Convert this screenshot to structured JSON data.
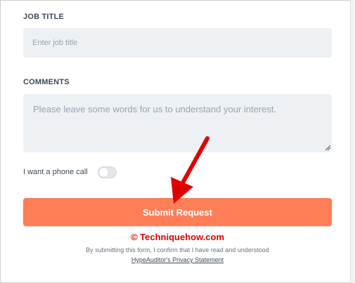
{
  "form": {
    "job_title_label": "JOB TITLE",
    "job_title_placeholder": "Enter job title",
    "job_title_value": "",
    "comments_label": "COMMENTS",
    "comments_placeholder": "Please leave some words for us to understand your interest.",
    "comments_value": "",
    "phone_call_label": "I want a phone call",
    "phone_call_on": false,
    "submit_label": "Submit Request",
    "consent_text": "By submitting this form, I confirm that I have read and understood",
    "privacy_link": "HypeAuditor's Privacy Statement"
  },
  "watermark": {
    "text": "© Techniquehow.com",
    "color": "#e10000"
  },
  "colors": {
    "accent": "#fd7e57",
    "input_bg": "#eef1f4",
    "arrow": "#e10000"
  },
  "icons": {
    "annotation": "red-arrow-icon",
    "resize": "resize-grip-icon"
  }
}
